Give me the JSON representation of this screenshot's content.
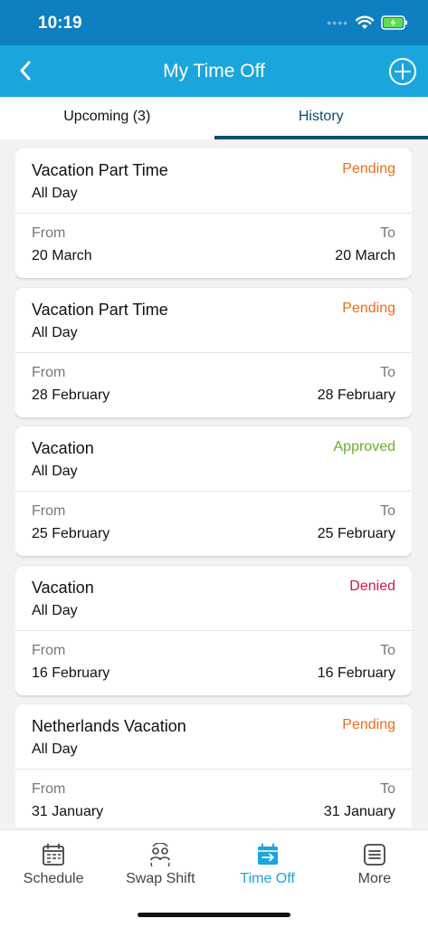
{
  "status_bar": {
    "time": "10:19"
  },
  "header": {
    "title": "My Time Off",
    "back_icon": "chevron-left-icon",
    "add_icon": "plus-circle-icon"
  },
  "tabs": [
    {
      "label": "Upcoming (3)",
      "active": false
    },
    {
      "label": "History",
      "active": true
    }
  ],
  "labels": {
    "from": "From",
    "to": "To"
  },
  "requests": [
    {
      "title": "Vacation Part Time",
      "status": "Pending",
      "status_color": "#f26a1b",
      "duration": "All Day",
      "from": "20 March",
      "to": "20 March"
    },
    {
      "title": "Vacation Part Time",
      "status": "Pending",
      "status_color": "#f26a1b",
      "duration": "All Day",
      "from": "28 February",
      "to": "28 February"
    },
    {
      "title": "Vacation",
      "status": "Approved",
      "status_color": "#6aad2f",
      "duration": "All Day",
      "from": "25 February",
      "to": "25 February"
    },
    {
      "title": "Vacation",
      "status": "Denied",
      "status_color": "#d4154a",
      "duration": "All Day",
      "from": "16 February",
      "to": "16 February"
    },
    {
      "title": "Netherlands Vacation",
      "status": "Pending",
      "status_color": "#f26a1b",
      "duration": "All Day",
      "from": "31 January",
      "to": "31 January"
    }
  ],
  "bottom_nav": [
    {
      "label": "Schedule",
      "icon": "calendar-icon",
      "active": false
    },
    {
      "label": "Swap Shift",
      "icon": "swap-people-icon",
      "active": false
    },
    {
      "label": "Time Off",
      "icon": "calendar-arrow-icon",
      "active": true
    },
    {
      "label": "More",
      "icon": "menu-icon",
      "active": false
    }
  ],
  "colors": {
    "header": "#1aa5dd",
    "status_bar": "#0e7fc0",
    "tab_active": "#0b4f72",
    "nav_active": "#1aa5dd"
  }
}
